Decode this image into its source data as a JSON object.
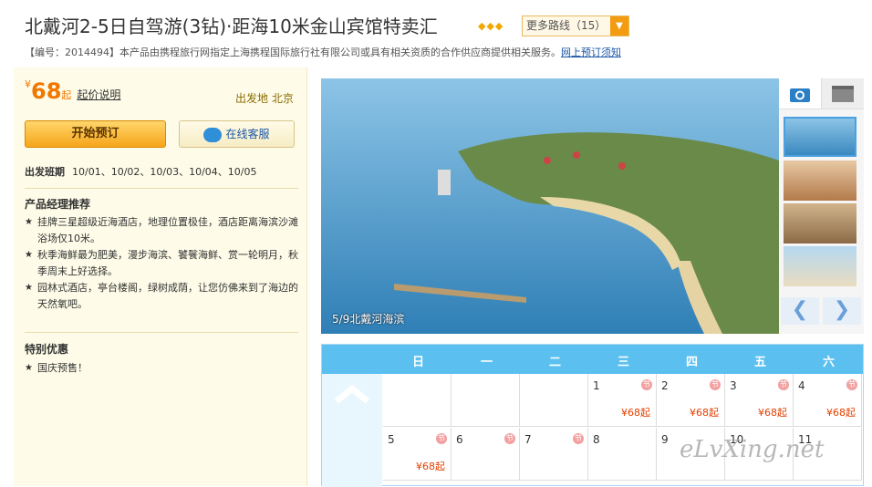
{
  "header": {
    "title": "北戴河2-5日自驾游(3钻)·距海10米金山宾馆特卖汇",
    "diamonds": "◆◆◆",
    "more_routes": "更多路线（15）",
    "product_info": "【编号：2014494】本产品由携程旅行网指定上海携程国际旅行社有限公司或具有相关资质的合作供应商提供相关服务。",
    "booking_notice": "网上预订须知"
  },
  "left": {
    "price_symbol": "¥",
    "price": "68",
    "price_suffix": "起",
    "price_explain": "起价说明",
    "depart": "出发地 北京",
    "book_button": "开始预订",
    "service_button": "在线客服",
    "schedule_label": "出发班期",
    "schedule_dates": "10/01、10/02、10/03、10/04、10/05",
    "recommend_title": "产品经理推荐",
    "recommend": [
      "挂牌三星超级近海酒店，地理位置极佳，酒店距离海滨沙滩浴场仅10米。",
      "秋季海鲜最为肥美，漫步海滨、饕餮海鲜、赏一轮明月，秋季周末上好选择。",
      "园林式酒店，亭台楼阁，绿树成荫，让您仿佛来到了海边的天然氧吧。"
    ],
    "special_title": "特别优惠",
    "special": [
      "国庆预售！"
    ]
  },
  "gallery": {
    "caption": "5/9北戴河海滨",
    "prev": "❮",
    "next": "❯"
  },
  "calendar": {
    "weekdays": [
      "日",
      "一",
      "二",
      "三",
      "四",
      "五",
      "六"
    ],
    "holiday_mark": "节",
    "row1": [
      {
        "day": "",
        "holiday": false,
        "price": ""
      },
      {
        "day": "",
        "holiday": false,
        "price": ""
      },
      {
        "day": "",
        "holiday": false,
        "price": ""
      },
      {
        "day": "1",
        "holiday": true,
        "price": "¥68起"
      },
      {
        "day": "2",
        "holiday": true,
        "price": "¥68起"
      },
      {
        "day": "3",
        "holiday": true,
        "price": "¥68起"
      },
      {
        "day": "4",
        "holiday": true,
        "price": "¥68起"
      }
    ],
    "row2": [
      {
        "day": "5",
        "holiday": true,
        "price": "¥68起"
      },
      {
        "day": "6",
        "holiday": true,
        "price": ""
      },
      {
        "day": "7",
        "holiday": true,
        "price": ""
      },
      {
        "day": "8",
        "holiday": false,
        "price": ""
      },
      {
        "day": "9",
        "holiday": false,
        "price": ""
      },
      {
        "day": "10",
        "holiday": false,
        "price": ""
      },
      {
        "day": "11",
        "holiday": false,
        "price": ""
      }
    ]
  },
  "watermark": "eLvXing.net"
}
